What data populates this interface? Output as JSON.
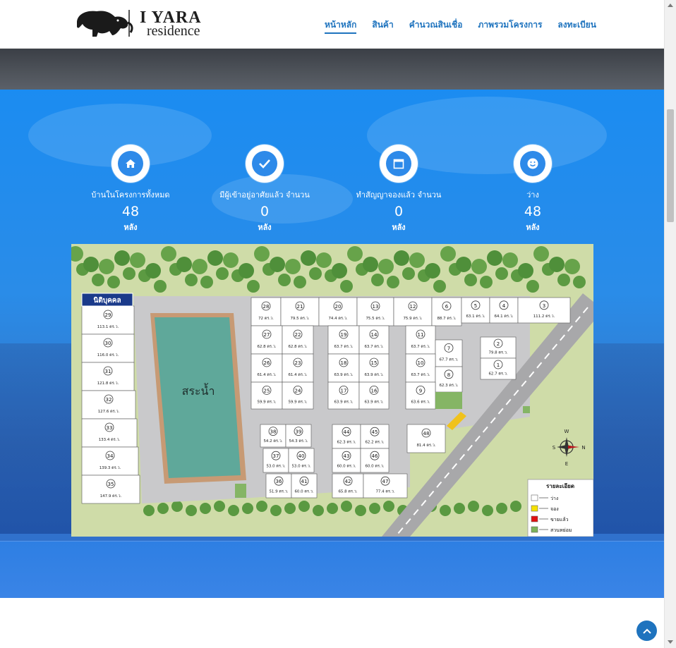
{
  "brand": {
    "line1": "YARA",
    "line2": "residence",
    "mark": "I"
  },
  "nav": [
    {
      "label": "หน้าหลัก",
      "active": true
    },
    {
      "label": "สินค้า",
      "active": false
    },
    {
      "label": "คำนวณสินเชื่อ",
      "active": false
    },
    {
      "label": "ภาพรวมโครงการ",
      "active": false
    },
    {
      "label": "ลงทะเบียน",
      "active": false
    }
  ],
  "stats": [
    {
      "icon": "home-icon",
      "label": "บ้านในโครงการทั้งหมด",
      "value": "48",
      "unit": "หลัง"
    },
    {
      "icon": "check-icon",
      "label": "มีผู้เข้าอยู่อาศัยแล้ว จำนวน",
      "value": "0",
      "unit": "หลัง"
    },
    {
      "icon": "calendar-icon",
      "label": "ทำสัญญาจองแล้ว จำนวน",
      "value": "0",
      "unit": "หลัง"
    },
    {
      "icon": "smile-icon",
      "label": "ว่าง",
      "value": "48",
      "unit": "หลัง"
    }
  ],
  "map": {
    "tag": "นิติบุคคล",
    "pond": "สระน้ำ",
    "legend_title": "รายละเอียด",
    "legend": [
      {
        "label": "ว่าง",
        "color": "#ffffff"
      },
      {
        "label": "จอง",
        "color": "#f5e100"
      },
      {
        "label": "ขายแล้ว",
        "color": "#e01010"
      },
      {
        "label": "สวนหย่อม",
        "color": "#7db35a"
      }
    ],
    "compass": {
      "n": "N",
      "s": "S",
      "e": "E",
      "w": "W"
    },
    "plots": [
      {
        "id": "29",
        "area": "113.1 ตร.ว."
      },
      {
        "id": "30",
        "area": "116.0 ตร.ว."
      },
      {
        "id": "31",
        "area": "121.8 ตร.ว."
      },
      {
        "id": "32",
        "area": "127.6 ตร.ว."
      },
      {
        "id": "33",
        "area": "133.4 ตร.ว."
      },
      {
        "id": "34",
        "area": "139.3 ตร.ว."
      },
      {
        "id": "35",
        "area": "147.9 ตร.ว."
      },
      {
        "id": "28",
        "area": "72 ตร.ว."
      },
      {
        "id": "21",
        "area": "79.5 ตร.ว."
      },
      {
        "id": "20",
        "area": "74.4 ตร.ว."
      },
      {
        "id": "13",
        "area": "75.5 ตร.ว."
      },
      {
        "id": "12",
        "area": "75.9 ตร.ว."
      },
      {
        "id": "6",
        "area": "88.7 ตร.ว."
      },
      {
        "id": "5",
        "area": "63.1 ตร.ว."
      },
      {
        "id": "4",
        "area": "64.1 ตร.ว."
      },
      {
        "id": "3",
        "area": "111.2 ตร.ว."
      },
      {
        "id": "27",
        "area": "62.8 ตร.ว."
      },
      {
        "id": "22",
        "area": "62.8 ตร.ว."
      },
      {
        "id": "19",
        "area": "63.7 ตร.ว."
      },
      {
        "id": "14",
        "area": "63.7 ตร.ว."
      },
      {
        "id": "11",
        "area": "63.7 ตร.ว."
      },
      {
        "id": "7",
        "area": "67.7 ตร.ว."
      },
      {
        "id": "2",
        "area": "79.8 ตร.ว."
      },
      {
        "id": "26",
        "area": "61.4 ตร.ว."
      },
      {
        "id": "23",
        "area": "61.4 ตร.ว."
      },
      {
        "id": "18",
        "area": "63.9 ตร.ว."
      },
      {
        "id": "15",
        "area": "63.9 ตร.ว."
      },
      {
        "id": "10",
        "area": "63.7 ตร.ว."
      },
      {
        "id": "8",
        "area": "62.3 ตร.ว."
      },
      {
        "id": "1",
        "area": "62.7 ตร.ว."
      },
      {
        "id": "25",
        "area": "59.9 ตร.ว."
      },
      {
        "id": "24",
        "area": "59.9 ตร.ว."
      },
      {
        "id": "17",
        "area": "63.9 ตร.ว."
      },
      {
        "id": "16",
        "area": "63.9 ตร.ว."
      },
      {
        "id": "9",
        "area": "63.6 ตร.ว."
      },
      {
        "id": "38",
        "area": "54.2 ตร.ว."
      },
      {
        "id": "39",
        "area": "54.3 ตร.ว."
      },
      {
        "id": "44",
        "area": "62.3 ตร.ว."
      },
      {
        "id": "45",
        "area": "62.2 ตร.ว."
      },
      {
        "id": "48",
        "area": "81.4 ตร.ว."
      },
      {
        "id": "37",
        "area": "53.0 ตร.ว."
      },
      {
        "id": "40",
        "area": "53.0 ตร.ว."
      },
      {
        "id": "43",
        "area": "60.0 ตร.ว."
      },
      {
        "id": "46",
        "area": "60.0 ตร.ว."
      },
      {
        "id": "36",
        "area": "51.9 ตร.ว."
      },
      {
        "id": "41",
        "area": "60.0 ตร.ว."
      },
      {
        "id": "42",
        "area": "65.8 ตร.ว."
      },
      {
        "id": "47",
        "area": "77.4 ตร.ว."
      }
    ]
  },
  "colors": {
    "accent": "#1e73be",
    "section_blue": "#2a8ce8"
  }
}
